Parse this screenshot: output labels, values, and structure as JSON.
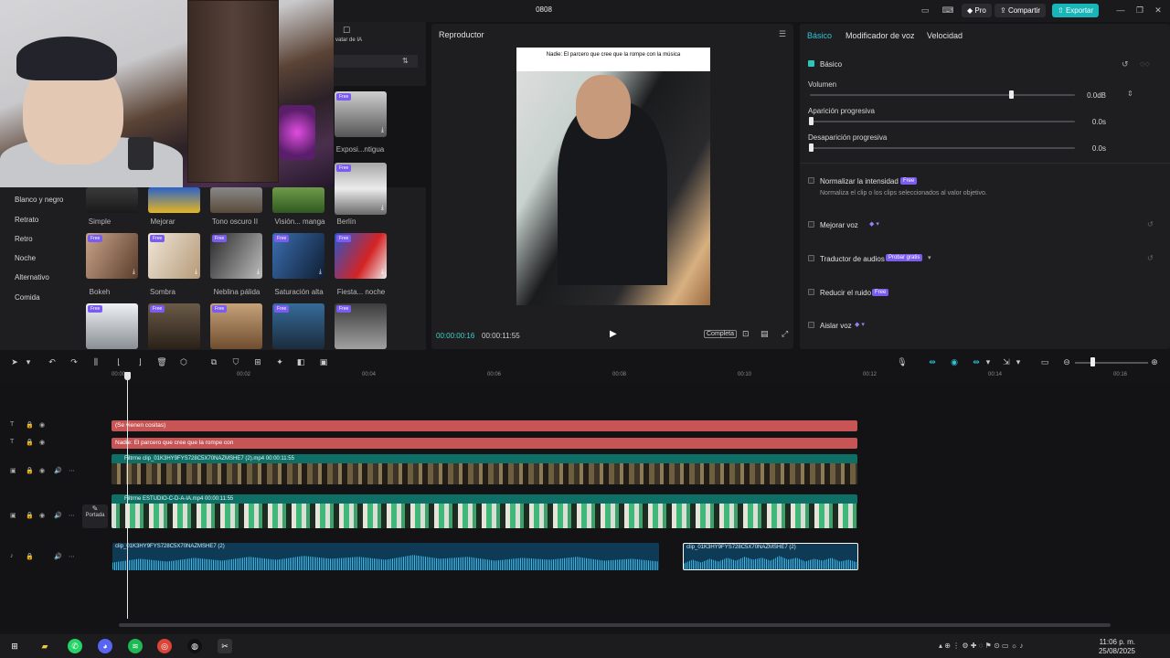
{
  "window": {
    "title": "0808",
    "pro_label": "Pro",
    "share_label": "Compartir",
    "export_label": "Exportar"
  },
  "left_top": {
    "label": "vatar de IA"
  },
  "filters": {
    "categories": [
      "Blanco y negro",
      "Retrato",
      "Retro",
      "Noche",
      "Alternativo",
      "Comida"
    ],
    "free_badge": "Free",
    "row0": [
      "Simple",
      "Mejorar",
      "Tono oscuro II",
      "Visión... manga",
      "Berlín"
    ],
    "row1": [
      "Bokeh",
      "Sombra",
      "Neblina pálida",
      "Saturación alta",
      "Fiesta... noche"
    ],
    "side_top": "Exposi...ntigua"
  },
  "player": {
    "title": "Reproductor",
    "caption": "Nadie: El parcero que cree que la rompe con la música",
    "current_time": "00:00:00:16",
    "duration": "00:00:11:55",
    "ratio_label": "Completa"
  },
  "props": {
    "tabs": [
      "Básico",
      "Modificador de voz",
      "Velocidad"
    ],
    "section": "Básico",
    "volume_label": "Volumen",
    "volume_value": "0.0dB",
    "volume_level": 0.76,
    "fadein_label": "Aparición progresiva",
    "fadein_value": "0.0s",
    "fadeout_label": "Desaparición progresiva",
    "fadeout_value": "0.0s",
    "normalize_label": "Normalizar la intensidad",
    "normalize_desc": "Normaliza el clip o los clips seleccionados al valor objetivo.",
    "enhance_label": "Mejorar voz",
    "translate_label": "Traductor de audios",
    "translate_badge": "Probar gratis",
    "noise_label": "Reducir el ruido",
    "isolate_label": "Aislar voz",
    "free_badge": "Free"
  },
  "timeline": {
    "ticks": [
      "00:00",
      "00:02",
      "00:04",
      "00:06",
      "00:08",
      "00:10",
      "00:12",
      "00:14",
      "00:16"
    ],
    "text_clip_1": "(Se vienen cositas)",
    "text_clip_2": "Nadie: El parcero que cree que la rompe con",
    "video_clip_1": "Filtrme  clip_01K3HY9FYS728C5X70NAZMSHE7 (2).mp4  00:00:11:55",
    "video_clip_2": "Filtrme  ESTUDIO-C-D-A-IA.mp4  00:00:11:55",
    "cover_label": "Portada",
    "audio_clip_1": "clip_01K3HY9FYS728C5X70NAZMSHE7 (2)",
    "audio_clip_2": "clip_01K3HY9FYS728C5X70NAZMSHE7 (2)"
  },
  "taskbar": {
    "time": "11:06 p. m.",
    "date": "25/08/2025"
  }
}
